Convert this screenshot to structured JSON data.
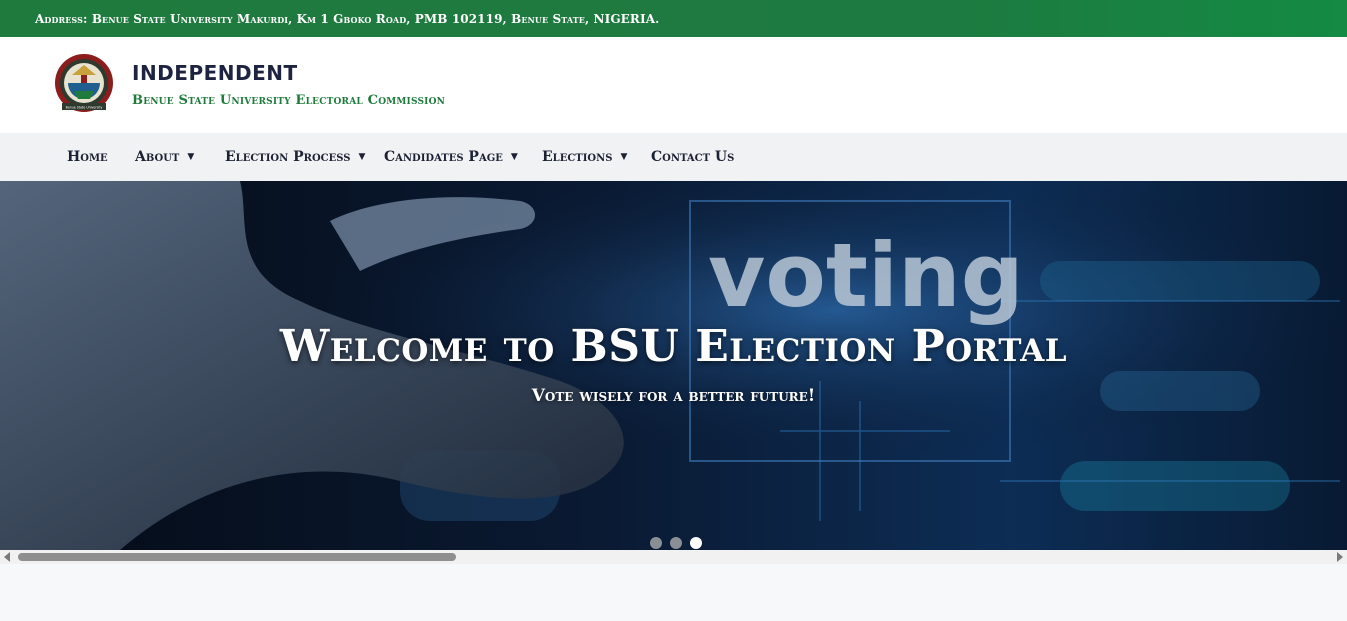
{
  "topbar": {
    "address": "Address: Benue State University Makurdi, Km 1 Gboko Road, PMB 102119, Benue State, NIGERIA."
  },
  "header": {
    "title": "INDEPENDENT",
    "subtitle": "Benue State University Electoral Commission",
    "logo_text": "Benue State University"
  },
  "nav": {
    "items": [
      {
        "label": "Home",
        "dropdown": false
      },
      {
        "label": "About",
        "dropdown": true
      },
      {
        "label": "Election Process",
        "dropdown": true
      },
      {
        "label": "Candidates Page",
        "dropdown": true
      },
      {
        "label": "Elections",
        "dropdown": true
      },
      {
        "label": "Contact Us",
        "dropdown": false
      }
    ],
    "caret": "▼"
  },
  "hero": {
    "image_text": "voting",
    "title": "Welcome to BSU Election Portal",
    "subtitle": "Vote wisely for a better future!",
    "slides": 3,
    "active_slide": 3
  },
  "colors": {
    "topbar_green": "#1f7a3e",
    "brand_navy": "#1d2340",
    "brand_green": "#1e7b3c",
    "nav_bg": "#f1f2f4"
  }
}
